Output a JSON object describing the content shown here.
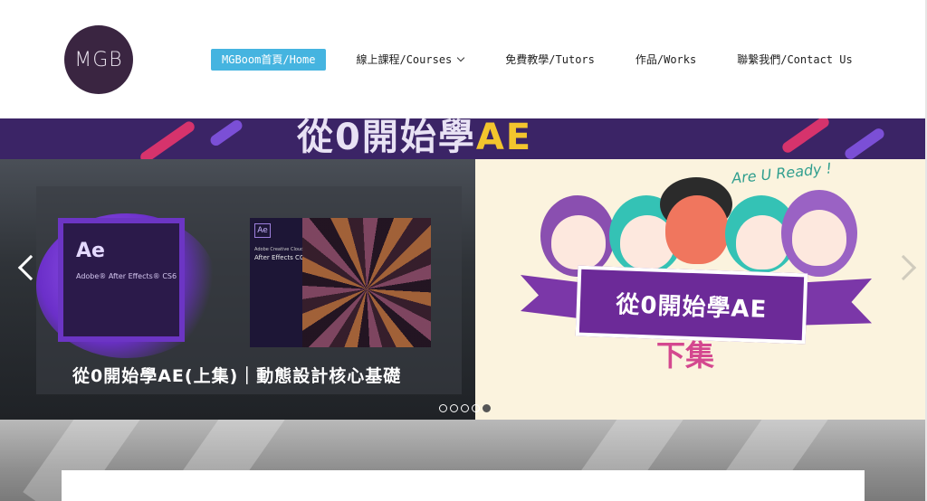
{
  "logo": {
    "text": "MGB"
  },
  "nav": {
    "home": "MGBoom首頁/Home",
    "courses": "線上課程/Courses",
    "tutors": "免費教學/Tutors",
    "works": "作品/Works",
    "contact": "聯繫我們/Contact Us"
  },
  "banner": {
    "title_cn": "從0開始學",
    "title_ae": "AE"
  },
  "slides": {
    "left": {
      "ae_logo": "Ae",
      "ae_caption": "Adobe® After Effects® CS6",
      "cc_logo": "Ae",
      "cc_line1": "Adobe Creative Cloud",
      "cc_line2": "After Effects CC",
      "caption": "從0開始學AE(上集)｜動態設計核心基礎"
    },
    "right": {
      "ready": "Are U Ready !",
      "ribbon": "從0開始學AE",
      "part": "下集"
    }
  },
  "carousel": {
    "dot_count": 5,
    "active_dot": 4
  },
  "colors": {
    "nav_active": "#45b4e0",
    "logo_bg": "#3a2541",
    "banner_bg": "#3b2466",
    "ribbon": "#6c2a98",
    "part_text": "#d4488f"
  }
}
